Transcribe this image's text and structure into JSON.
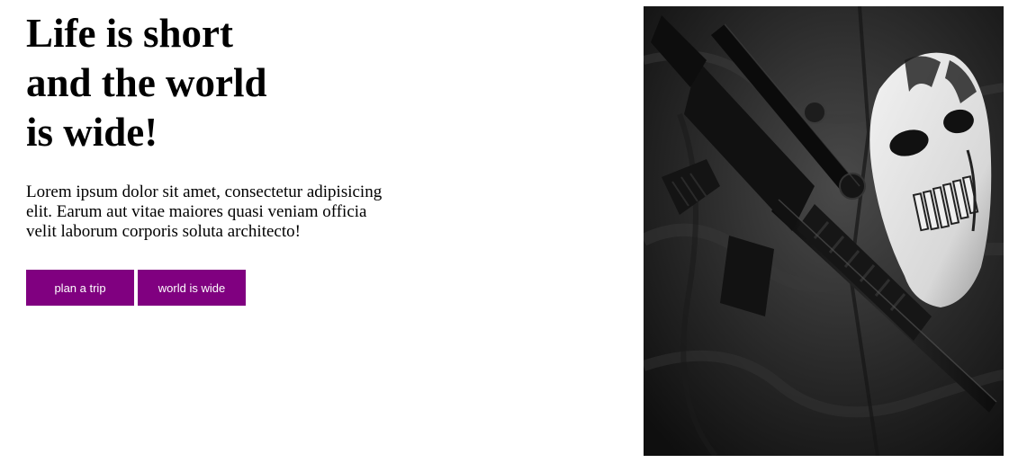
{
  "hero": {
    "headline_lines": [
      "Life is short",
      "and the world",
      "is wide!"
    ],
    "body": "Lorem ipsum dolor sit amet, consectetur adipisicing elit. Earum aut vitae maiores quasi veniam officia velit laborum corporis soluta architecto!"
  },
  "actions": {
    "plan_label": "plan a trip",
    "world_label": "world is wide"
  },
  "colors": {
    "button_bg": "#800080",
    "button_text": "#ffffff"
  },
  "photo": {
    "subject": "rifle-and-mask-photo"
  }
}
